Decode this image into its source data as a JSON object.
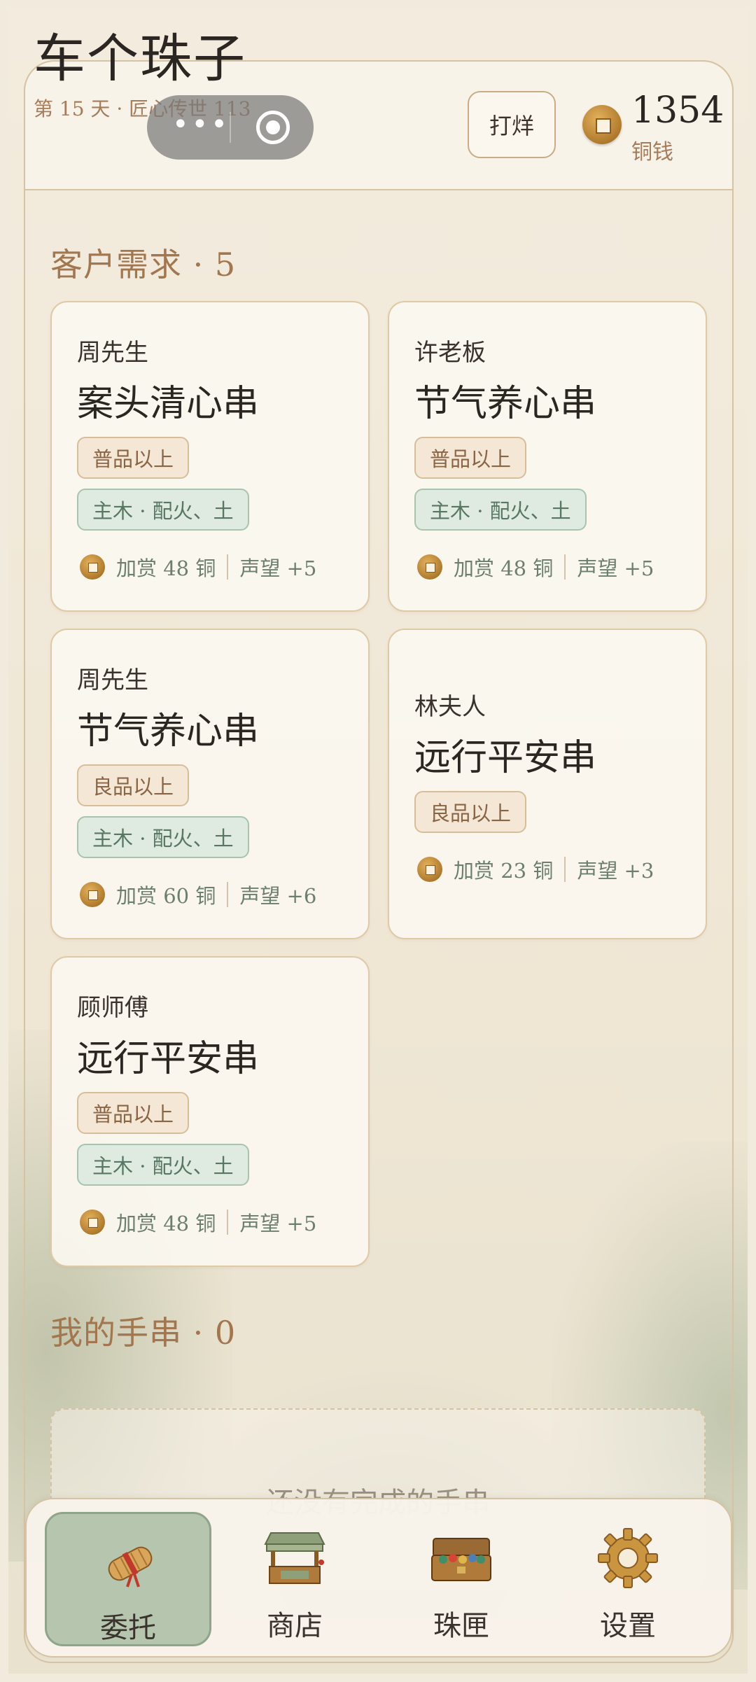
{
  "header": {
    "title": "车个珠子",
    "subtitle": "第 15 天 · 匠心传世 113",
    "action_button": "打烊",
    "coins_value": "1354",
    "coins_label": "铜钱"
  },
  "demand_section": {
    "title": "客户需求 · 5",
    "cards": [
      {
        "customer": "周先生",
        "product": "案头清心串",
        "grade": "普品以上",
        "elements": "主木 · 配火、土",
        "bonus": "加赏 48 铜",
        "reputation": "声望 +5"
      },
      {
        "customer": "许老板",
        "product": "节气养心串",
        "grade": "普品以上",
        "elements": "主木 · 配火、土",
        "bonus": "加赏 48 铜",
        "reputation": "声望 +5"
      },
      {
        "customer": "周先生",
        "product": "节气养心串",
        "grade": "良品以上",
        "elements": "主木 · 配火、土",
        "bonus": "加赏 60 铜",
        "reputation": "声望 +6"
      },
      {
        "customer": "林夫人",
        "product": "远行平安串",
        "grade": "良品以上",
        "elements": "",
        "bonus": "加赏 23 铜",
        "reputation": "声望 +3"
      },
      {
        "customer": "顾师傅",
        "product": "远行平安串",
        "grade": "普品以上",
        "elements": "主木 · 配火、土",
        "bonus": "加赏 48 铜",
        "reputation": "声望 +5"
      }
    ]
  },
  "bracelet_section": {
    "title": "我的手串 · 0",
    "empty_text": "还没有完成的手串"
  },
  "nav": {
    "items": [
      {
        "label": "委托",
        "icon": "scroll-icon",
        "active": true
      },
      {
        "label": "商店",
        "icon": "shop-stall-icon",
        "active": false
      },
      {
        "label": "珠匣",
        "icon": "bead-chest-icon",
        "active": false
      },
      {
        "label": "设置",
        "icon": "gear-icon",
        "active": false
      }
    ]
  },
  "colors": {
    "accent_brown": "#a2774f",
    "elem_green": "#dfeae0",
    "nav_active": "#b6c5ad"
  }
}
